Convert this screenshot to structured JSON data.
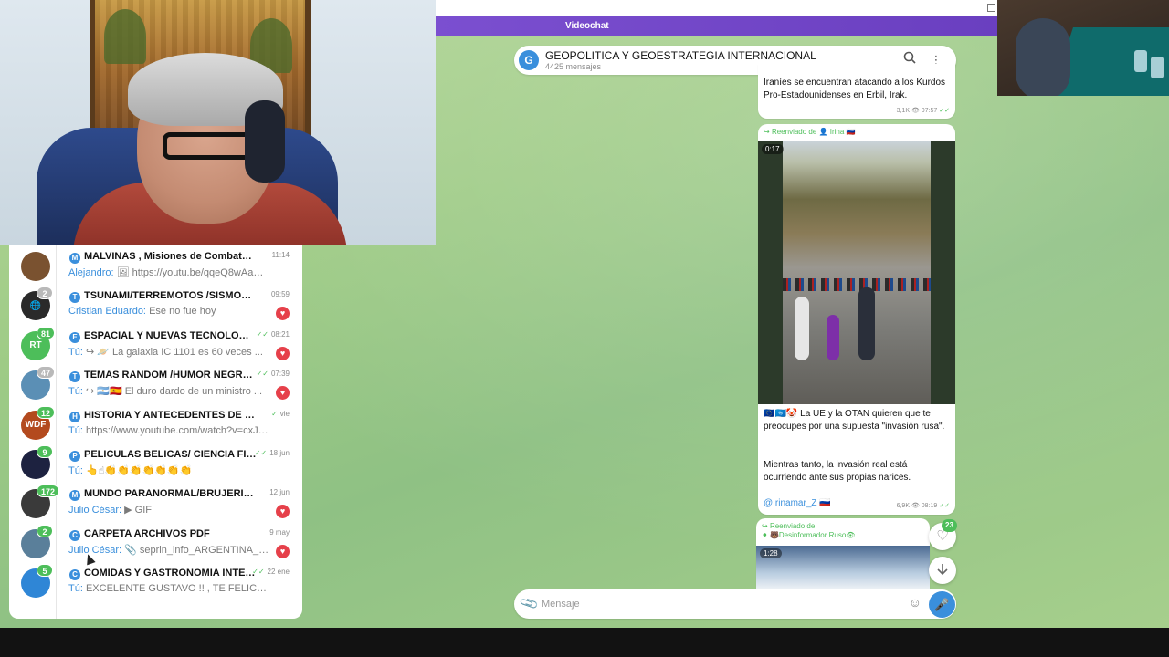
{
  "videochat": {
    "label": "Videochat"
  },
  "channel": {
    "logo_letter": "G",
    "title": "GEOPOLITICA Y GEOESTRATEGIA INTERNACIONAL",
    "subtitle": "4425 mensajes",
    "icons": {
      "search": "search-icon",
      "more": "more-vertical-icon"
    }
  },
  "chat_list": [
    {
      "name": "MALVINAS , Misiones de Combate , Her...",
      "channel_letter": "M",
      "time": "11:14",
      "ticks": "",
      "sender": "Alejandro:",
      "preview": "🖼 https://youtu.be/qqeQ8wAaYFY?si...",
      "badge": "",
      "heart": false,
      "avatar_color": "#7a5230",
      "avatar_label": ""
    },
    {
      "name": "TSUNAMI/TERREMOTOS /SISMOS/ CLI...",
      "channel_letter": "T",
      "time": "09:59",
      "ticks": "",
      "sender": "Cristian Eduardo:",
      "preview": "Ese no fue hoy",
      "badge": "2",
      "badge_muted": true,
      "heart": true,
      "avatar_color": "#2a2a2a",
      "avatar_label": "🌐"
    },
    {
      "name": "ESPACIAL Y NUEVAS TECNOLOGIAS ...",
      "channel_letter": "E",
      "time": "08:21",
      "ticks": "✓✓",
      "sender": "Tú:",
      "preview": "↪ 🪐 La galaxia IC 1101 es 60 veces ...",
      "badge": "81",
      "badge_muted": false,
      "heart": true,
      "avatar_color": "#4dbe5a",
      "avatar_label": "RT"
    },
    {
      "name": "TEMAS RANDOM /HUMOR NEGRO Y ...",
      "channel_letter": "T",
      "time": "07:39",
      "ticks": "✓✓",
      "sender": "Tú:",
      "preview": "↪ 🇦🇷🇪🇸 El duro dardo de un ministro ...",
      "badge": "47",
      "badge_muted": true,
      "heart": true,
      "avatar_color": "#5b8fb5",
      "avatar_label": ""
    },
    {
      "name": "HISTORIA Y ANTECEDENTES DE LA GE...",
      "channel_letter": "H",
      "time": "vie",
      "ticks": "✓",
      "sender": "Tú:",
      "preview": "https://www.youtube.com/watch?v=cxJg...",
      "badge": "12",
      "badge_muted": false,
      "heart": false,
      "avatar_color": "#b34a1e",
      "avatar_label": "WDF"
    },
    {
      "name": "PELICULAS BELICAS/ CIENCIA FICCI...",
      "channel_letter": "P",
      "time": "18 jun",
      "ticks": "✓✓",
      "sender": "Tú:",
      "preview": "👆☝👏👏👏👏👏👏👏",
      "badge": "9",
      "badge_muted": false,
      "heart": false,
      "avatar_color": "#1d2240",
      "avatar_label": ""
    },
    {
      "name": "MUNDO PARANORMAL/BRUJERIA/AST...",
      "channel_letter": "M",
      "time": "12 jun",
      "ticks": "",
      "sender": "Julio César:",
      "preview": "▶ GIF",
      "badge": "172",
      "badge_muted": false,
      "heart": true,
      "avatar_color": "#3a3a3a",
      "avatar_label": ""
    },
    {
      "name": "CARPETA ARCHIVOS PDF",
      "channel_letter": "C",
      "time": "9 may",
      "ticks": "",
      "sender": "Julio César:",
      "preview": "📎 seprin_info_ARGENTINA_INV...",
      "badge": "2",
      "badge_muted": false,
      "heart": true,
      "avatar_color": "#5a7f9a",
      "avatar_label": ""
    },
    {
      "name": "COMIDAS Y GASTRONOMIA INTER...",
      "channel_letter": "C",
      "time": "22 ene",
      "ticks": "✓✓",
      "sender": "Tú:",
      "preview": "EXCELENTE GUSTAVO !! , TE FELICITO !! TOD...",
      "badge": "5",
      "badge_muted": false,
      "heart": false,
      "avatar_color": "#2f86d6",
      "avatar_label": ""
    }
  ],
  "messages": {
    "m1": {
      "text": "Iraníes se encuentran atacando a los Kurdos Pro-Estadounidenses en Erbil, Irak.",
      "views": "3,1K",
      "time": "07:57",
      "ticks": "✓✓"
    },
    "m2": {
      "forwarded_prefix": "Reenviado de",
      "forwarded_from": "Irina 🇷🇺",
      "duration": "0:17",
      "text1": "🇪🇺🇺🇳🤡 La UE y la OTAN quieren que te preocupes por una supuesta \"invasión rusa\".",
      "text2": "Mientras tanto, la invasión real está ocurriendo ante sus propias narices.",
      "author": "@Irinamar_Z 🇷🇺",
      "views": "6,9K",
      "time": "08:19",
      "ticks": "✓✓"
    },
    "m3": {
      "forwarded_prefix": "Reenviado de",
      "forwarded_from": "🐻Desinformador Ruso👁",
      "duration": "1:28"
    }
  },
  "reaction_count": "23",
  "composer": {
    "placeholder": "Mensaje"
  },
  "colors": {
    "accent": "#3a8fdc",
    "unread": "#4dbe5a",
    "videochat": "#7b4fd0",
    "heart": "#e6404a"
  }
}
